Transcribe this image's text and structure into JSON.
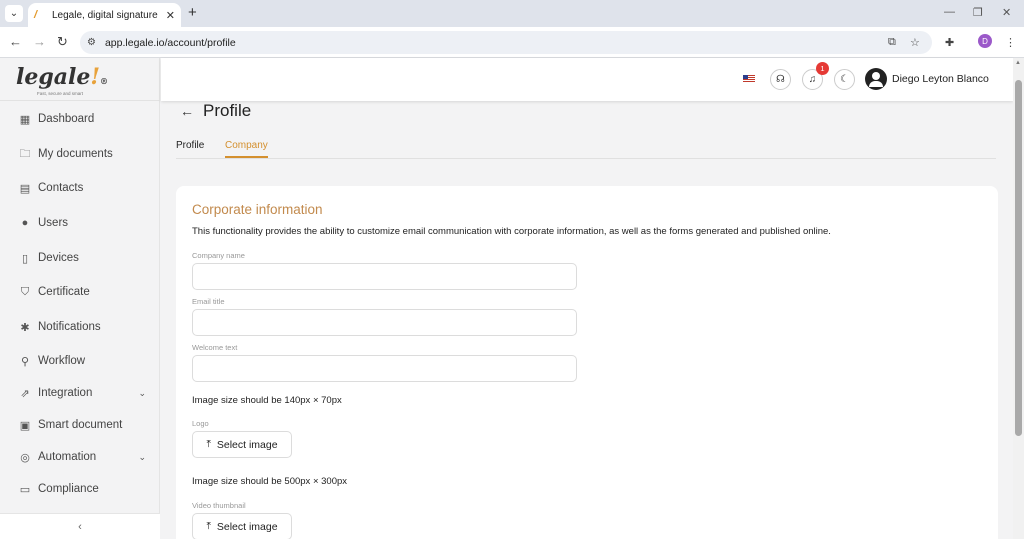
{
  "browser": {
    "tab_title": "Legale, digital signature",
    "url": "app.legale.io/account/profile",
    "profile_initial": "D"
  },
  "brand": {
    "logo_text": "legale",
    "logo_mark": "!",
    "logo_reg": "®",
    "tagline": "Fast, secure and smart",
    "accent_color": "#d4902f"
  },
  "sidebar": {
    "items": [
      {
        "label": "Dashboard",
        "icon": "dashboard-icon"
      },
      {
        "label": "My documents",
        "icon": "folder-icon"
      },
      {
        "label": "Contacts",
        "icon": "contacts-icon"
      },
      {
        "label": "Users",
        "icon": "user-icon"
      },
      {
        "label": "Devices",
        "icon": "tablet-icon"
      },
      {
        "label": "Certificate",
        "icon": "shield-check-icon"
      },
      {
        "label": "Notifications",
        "icon": "bell-icon"
      },
      {
        "label": "Workflow",
        "icon": "workflow-icon"
      },
      {
        "label": "Integration",
        "icon": "external-link-icon"
      },
      {
        "label": "Smart document",
        "icon": "smart-document-icon"
      },
      {
        "label": "Automation",
        "icon": "automation-icon"
      },
      {
        "label": "Compliance",
        "icon": "chat-icon"
      }
    ],
    "collapse_glyph": "‹"
  },
  "header": {
    "notification_count": "1",
    "user_name": "Diego Leyton Blanco"
  },
  "page": {
    "title": "Profile",
    "tabs": [
      {
        "label": "Profile",
        "active": false
      },
      {
        "label": "Company",
        "active": true
      }
    ]
  },
  "form": {
    "section_title": "Corporate information",
    "description": "This functionality provides the ability to customize email communication with corporate information, as well as the forms generated and published online.",
    "company_name_label": "Company name",
    "company_name_value": "",
    "email_title_label": "Email title",
    "email_title_value": "",
    "welcome_text_label": "Welcome text",
    "welcome_text_value": "",
    "logo_hint": "Image size should be 140px × 70px",
    "logo_label": "Logo",
    "logo_button": "Select image",
    "video_hint": "Image size should be 500px × 300px",
    "video_label": "Video thumbnail",
    "video_button": "Select image"
  }
}
